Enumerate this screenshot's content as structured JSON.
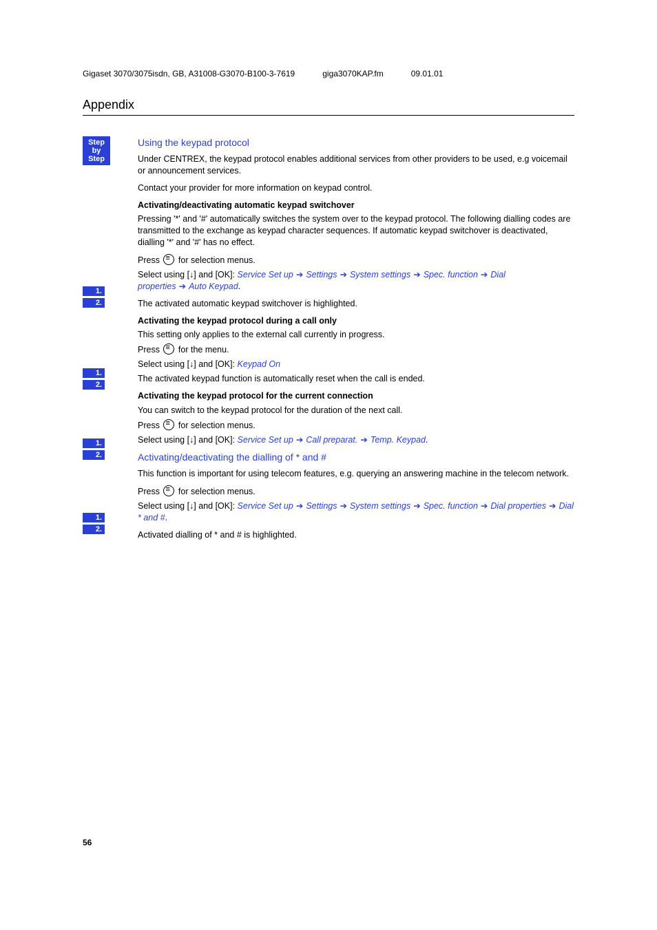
{
  "header": {
    "doc_id": "Gigaset 3070/3075isdn, GB, A31008-G3070-B100-3-7619",
    "filename": "giga3070KAP.fm",
    "date": "09.01.01"
  },
  "section_title": "Appendix",
  "step_badge": {
    "l1": "Step",
    "l2": "by",
    "l3": "Step"
  },
  "nums": {
    "one": "1.",
    "two": "2."
  },
  "h_keypad": "Using the keypad protocol",
  "p_keypad_1": "Under CENTREX, the keypad protocol enables additional services from other providers to be used, e.g voicemail or announcement services.",
  "p_keypad_2": "Contact your provider for more information on keypad control.",
  "h_auto": "Activating/deactivating automatic keypad switchover",
  "p_auto": "Pressing '*' and '#' automatically switches the system over to the keypad pro­tocol. The following dialling codes are transmitted to the exchange as keypad character sequences. If automatic keypad switchover is deactivated, dialling '*' and '#' has no effect.",
  "press_sel": "Press ",
  "press_sel_after": " for selection menus.",
  "select_prefix": "Select using [",
  "select_mid": "] and [OK]: ",
  "path1": {
    "a": "Service Set up",
    "b": "Settings",
    "c": "System settings",
    "d": "Spec. function",
    "e": "Dial properties",
    "f": "Auto Keypad"
  },
  "p_auto_end": "The activated automatic keypad switchover is highlighted.",
  "h_call": "Activating the keypad protocol during a call only",
  "p_call": "This setting only applies to the external call currently in progress.",
  "press_menu_after": " for the menu.",
  "path2": {
    "a": "Keypad On"
  },
  "p_call_end": "The activated keypad function is automatically reset when the call is ended.",
  "h_conn": "Activating the keypad protocol for the current connection",
  "p_conn": "You can switch to the keypad protocol for the duration of the next call.",
  "path3": {
    "a": "Service Set up",
    "b": "Call preparat.",
    "c": "Temp. Keypad"
  },
  "h_dial": "Activating/deactivating the dialling of * and #",
  "p_dial": "This function is important for using telecom features, e.g. querying an answer­ing machine in the telecom network.",
  "path4": {
    "a": "Service Set up",
    "b": "Settings",
    "c": "System settings",
    "d": "Spec. function",
    "e": "Dial properties",
    "f": "Dial * and #"
  },
  "p_dial_end": "Activated dialling of * and # is highlighted.",
  "page_number": "56"
}
